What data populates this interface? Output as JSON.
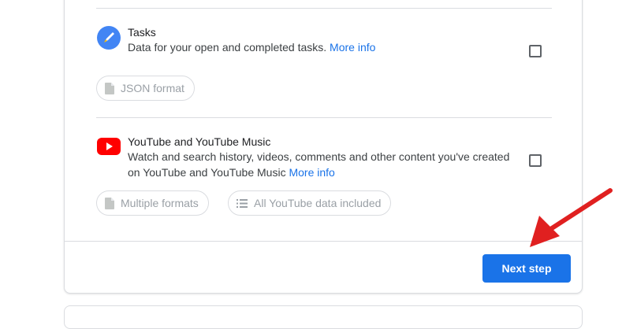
{
  "products": [
    {
      "title": "Tasks",
      "description": "Data for your open and completed tasks.",
      "more_info": "More info",
      "icon": "tasks-icon",
      "chips": [
        {
          "icon": "document-icon",
          "label": "JSON format"
        }
      ],
      "checked": false
    },
    {
      "title": "YouTube and YouTube Music",
      "description_line1": "Watch and search history, videos, comments and other content you've created",
      "description_line2": "on YouTube and YouTube Music",
      "more_info": "More info",
      "icon": "youtube-icon",
      "chips": [
        {
          "icon": "document-icon",
          "label": "Multiple formats"
        },
        {
          "icon": "list-icon",
          "label": "All YouTube data included"
        }
      ],
      "checked": false
    }
  ],
  "footer": {
    "next_step_label": "Next step"
  },
  "colors": {
    "accent": "#1a73e8",
    "youtube_red": "#ff0000",
    "tasks_blue": "#4285f4",
    "annotation_arrow": "#e02020"
  }
}
